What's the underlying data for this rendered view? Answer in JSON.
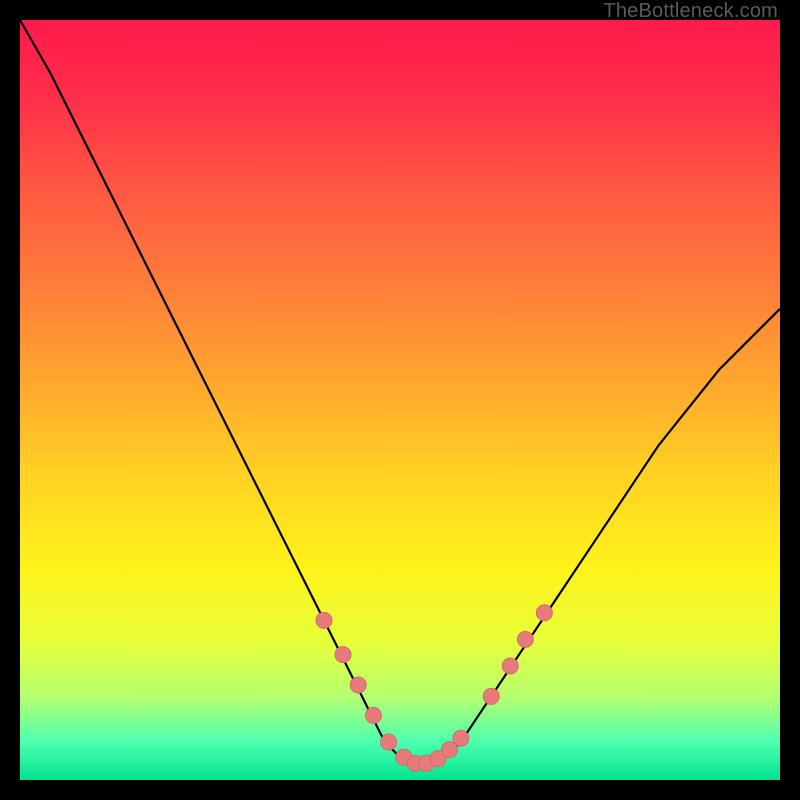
{
  "watermark": "TheBottleneck.com",
  "colors": {
    "curve_stroke": "#000000",
    "marker_fill": "#e77b7b",
    "marker_stroke": "#d46a6a"
  },
  "chart_data": {
    "type": "line",
    "title": "",
    "xlabel": "",
    "ylabel": "",
    "xlim": [
      0,
      100
    ],
    "ylim": [
      0,
      100
    ],
    "series": [
      {
        "name": "bottleneck-curve",
        "x": [
          0,
          4,
          8,
          12,
          16,
          20,
          24,
          28,
          32,
          36,
          40,
          42,
          44,
          46,
          48,
          50,
          52,
          54,
          56,
          58,
          60,
          64,
          68,
          72,
          76,
          80,
          84,
          88,
          92,
          96,
          100
        ],
        "y": [
          100,
          93,
          85,
          77,
          69,
          61,
          53,
          45,
          37,
          29,
          21,
          17,
          13,
          9,
          5,
          3,
          2,
          2,
          3,
          5,
          8,
          14,
          20,
          26,
          32,
          38,
          44,
          49,
          54,
          58,
          62
        ]
      }
    ],
    "markers": {
      "name": "highlighted-points",
      "x": [
        40,
        42.5,
        44.5,
        46.5,
        48.5,
        50.5,
        52,
        53.5,
        55,
        56.5,
        58,
        62,
        64.5,
        66.5,
        69
      ],
      "y": [
        21,
        16.5,
        12.5,
        8.5,
        5,
        3,
        2.2,
        2.2,
        2.8,
        4,
        5.5,
        11,
        15,
        18.5,
        22
      ]
    }
  }
}
